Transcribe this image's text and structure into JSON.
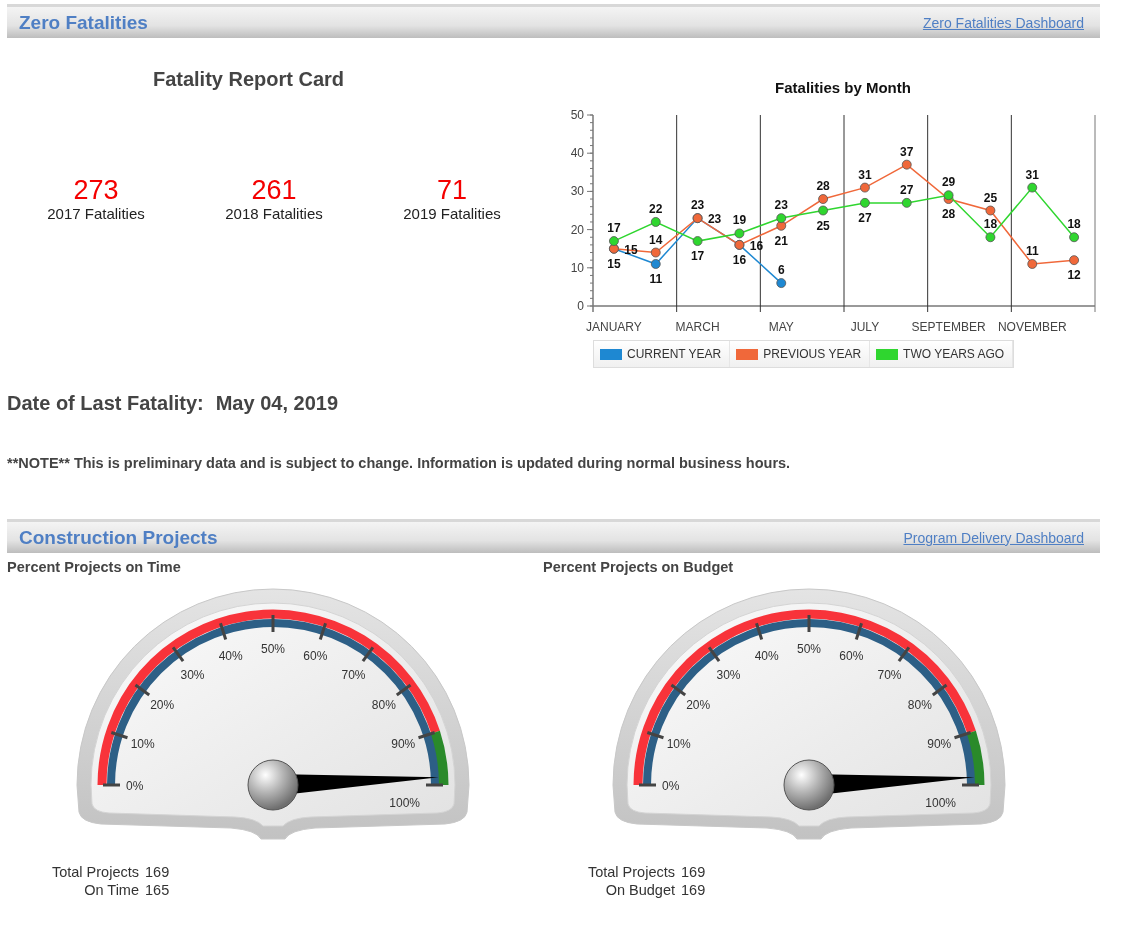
{
  "fatalities_header": {
    "title": "Zero Fatalities",
    "link": "Zero Fatalities Dashboard"
  },
  "report_card": {
    "title": "Fatality Report Card",
    "stats": [
      {
        "value": "273",
        "label": "2017 Fatalities"
      },
      {
        "value": "261",
        "label": "2018 Fatalities"
      },
      {
        "value": "71",
        "label": "2019 Fatalities"
      }
    ]
  },
  "monthly_chart": {
    "chart_data": {
      "type": "line",
      "title": "Fatalities by Month",
      "categories": [
        "JANUARY",
        null,
        "MARCH",
        null,
        "MAY",
        null,
        "JULY",
        null,
        "SEPTEMBER",
        null,
        "NOVEMBER",
        null
      ],
      "legend": "bottom",
      "ylim": [
        0,
        50
      ],
      "yticks": [
        0,
        10,
        20,
        30,
        40,
        50
      ],
      "data_labels": true,
      "series": [
        {
          "name": "CURRENT YEAR",
          "color": "#1e88d2",
          "marker": "circle",
          "values": [
            15,
            11,
            23,
            16,
            6,
            null,
            null,
            null,
            null,
            null,
            null,
            null
          ]
        },
        {
          "name": "PREVIOUS YEAR",
          "color": "#f0683a",
          "marker": "circle",
          "values": [
            15,
            14,
            23,
            16,
            21,
            28,
            31,
            37,
            28,
            25,
            11,
            12
          ]
        },
        {
          "name": "TWO YEARS AGO",
          "color": "#2fd62f",
          "marker": "circle",
          "values": [
            17,
            22,
            17,
            19,
            23,
            25,
            27,
            27,
            29,
            18,
            31,
            18
          ]
        }
      ]
    }
  },
  "last_fatality": {
    "label": "Date of Last Fatality:",
    "value": "May 04, 2019"
  },
  "note": "**NOTE** This is preliminary data and is subject to change. Information is updated during normal business hours.",
  "construction_header": {
    "title": "Construction Projects",
    "link": "Program Delivery Dashboard"
  },
  "gauges": [
    {
      "title": "Percent Projects on Time",
      "ticks": [
        "0%",
        "10%",
        "20%",
        "30%",
        "40%",
        "50%",
        "60%",
        "70%",
        "80%",
        "90%",
        "100%"
      ],
      "totals": [
        {
          "label": "Total Projects",
          "value": "169"
        },
        {
          "label": "On Time",
          "value": "165"
        }
      ]
    },
    {
      "title": "Percent Projects on Budget",
      "ticks": [
        "0%",
        "10%",
        "20%",
        "30%",
        "40%",
        "50%",
        "60%",
        "70%",
        "80%",
        "90%",
        "100%"
      ],
      "totals": [
        {
          "label": "Total Projects",
          "value": "169"
        },
        {
          "label": "On Budget",
          "value": "169"
        }
      ]
    }
  ]
}
